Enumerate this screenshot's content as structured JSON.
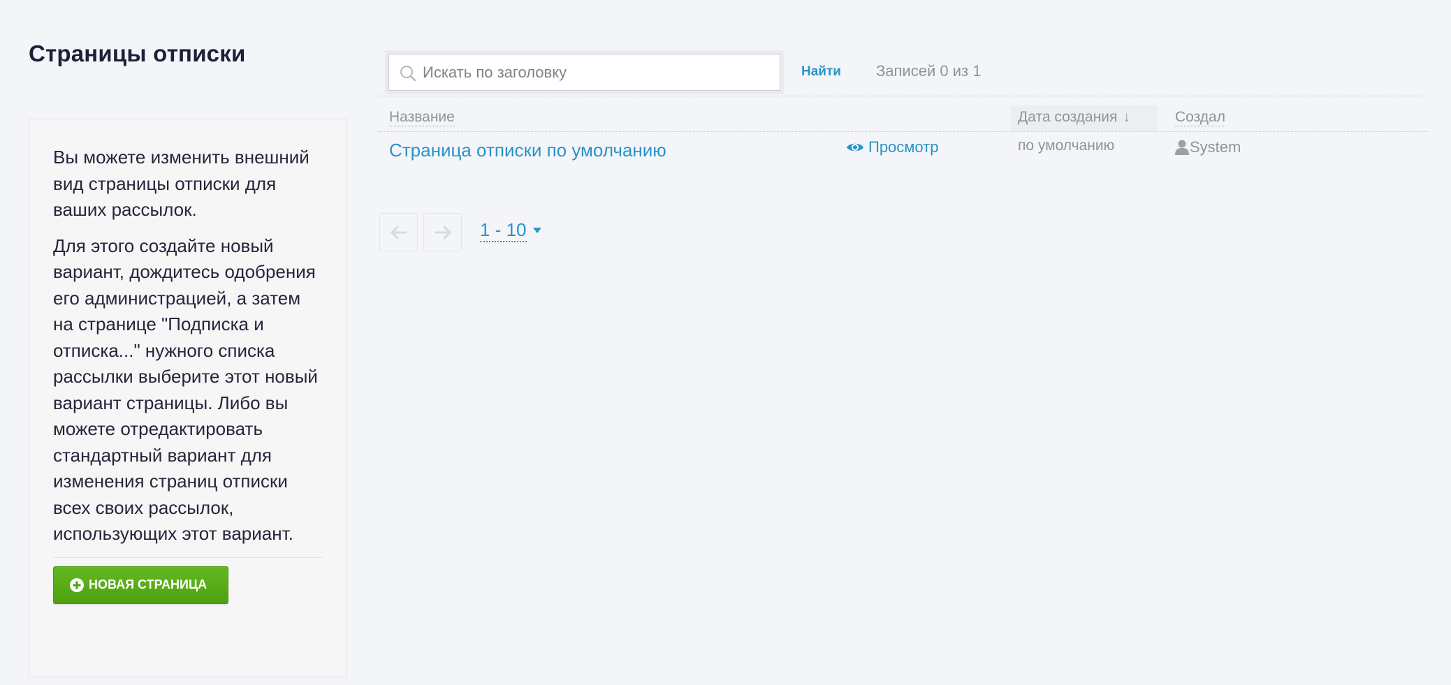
{
  "page": {
    "title": "Страницы отписки"
  },
  "info_panel": {
    "paragraph_1": "Вы можете изменить внешний вид страницы отписки для ваших рассылок.",
    "paragraph_2": "Для этого создайте новый вариант, дождитесь одобрения его администрацией, а затем на странице \"Подписка и отписка...\" нужного списка рассылки выберите этот новый вариант страницы. Либо вы можете отредактировать стандартный вариант для изменения страниц отписки всех своих рассылок, использующих этот вариант.",
    "new_page_button_label": "Новая страница",
    "new_page_button_icon": "plus-circle-icon"
  },
  "search": {
    "placeholder": "Искать по заголовку",
    "value": "",
    "find_label": "Найти",
    "records_count": "Записей 0 из 1"
  },
  "table": {
    "columns": {
      "name": "Название",
      "created_date": "Дата создания",
      "created_by": "Создал"
    },
    "sort_indicator": "↓",
    "rows": [
      {
        "title": "Страница отписки по умолчанию",
        "preview_label": "Просмотр",
        "created_date": "по умолчанию",
        "created_by": "System"
      }
    ]
  },
  "pagination": {
    "prev_icon": "arrow-left-icon",
    "next_icon": "arrow-right-icon",
    "page_size_label": "1 - 10"
  },
  "colors": {
    "link": "#2a93c6",
    "button_green": "#57ab15",
    "muted_text": "#8e939b",
    "background": "#f4f5f9"
  }
}
